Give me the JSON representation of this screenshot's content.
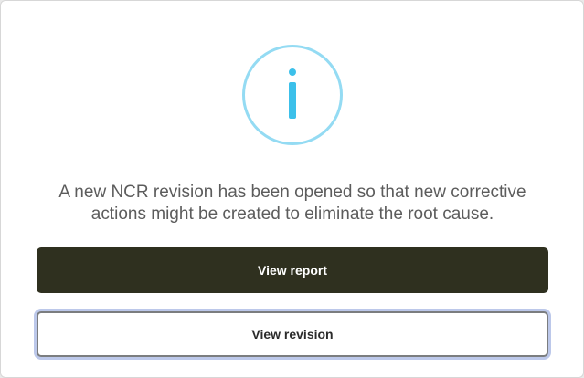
{
  "dialog": {
    "icon": "info-icon",
    "icon_glyph": "i",
    "message_line1": "A new NCR revision has been opened so that new corrective",
    "message_line2": "actions might be created to eliminate the root cause.",
    "primary_button_label": "View report",
    "secondary_button_label": "View revision"
  },
  "colors": {
    "icon_ring": "#94dbf3",
    "icon_glyph": "#3cc0ea",
    "primary_button": "#2f301f",
    "focus_ring": "#bcc8ea"
  }
}
